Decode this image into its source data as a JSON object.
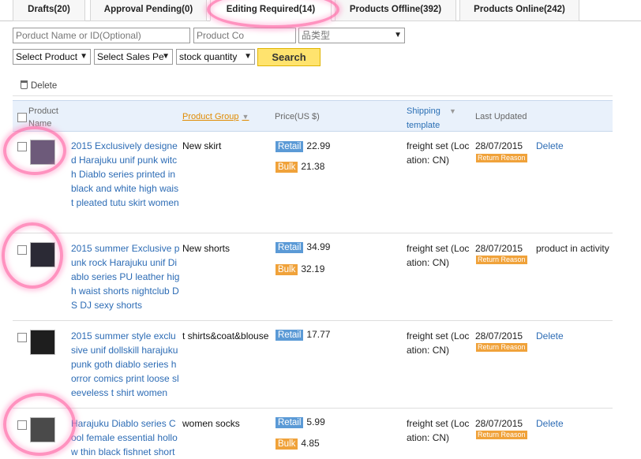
{
  "tabs": [
    {
      "label": "Drafts(20)"
    },
    {
      "label": "Approval Pending(0)"
    },
    {
      "label": "Editing Required(14)"
    },
    {
      "label": "Products Offline(392)"
    },
    {
      "label": "Products Online(242)"
    }
  ],
  "filters": {
    "product_name_placeholder": "Porduct Name or ID(Optional)",
    "product_code_placeholder": "Product Co",
    "category_placeholder": "品类型",
    "select_product": "Select Product",
    "select_sales": "Select Sales Pe",
    "stock_quantity": "stock quantity",
    "search_label": "Search"
  },
  "toolbar": {
    "delete_label": "Delete"
  },
  "columns": {
    "product_name": "Product Name",
    "product_group": "Product Group",
    "price": "Price(US $)",
    "shipping": "Shipping template",
    "last_updated": "Last Updated"
  },
  "labels": {
    "retail": "Retail",
    "bulk": "Bulk",
    "return_reason": "Return Reason"
  },
  "rows": [
    {
      "name": "2015 Exclusively designed Harajuku unif punk witch Diablo series printed in black and white high waist pleated tutu skirt women",
      "group": "New skirt",
      "retail": "22.99",
      "bulk": "21.38",
      "shipping": "freight set (Location: CN)",
      "date": "28/07/2015",
      "action": "Delete"
    },
    {
      "name": "2015 summer Exclusive punk rock Harajuku unif Diablo series PU leather high waist shorts nightclub DS DJ sexy shorts",
      "group": "New shorts",
      "retail": "34.99",
      "bulk": "32.19",
      "shipping": "freight set (Location: CN)",
      "date": "28/07/2015",
      "action": "product in activity"
    },
    {
      "name": "2015 summer style exclusive unif dollskill harajuku punk goth diablo series horror comics print loose sleeveless t shirt women",
      "group": "t shirts&coat&blouse",
      "retail": "17.77",
      "shipping": "freight set (Location: CN)",
      "date": "28/07/2015",
      "action": "Delete"
    },
    {
      "name": "Harajuku Diablo series Cool female essential hollow thin black fishnet short",
      "group": "women socks",
      "retail": "5.99",
      "bulk": "4.85",
      "shipping": "freight set (Location: CN)",
      "date": "28/07/2015",
      "action": "Delete"
    }
  ]
}
